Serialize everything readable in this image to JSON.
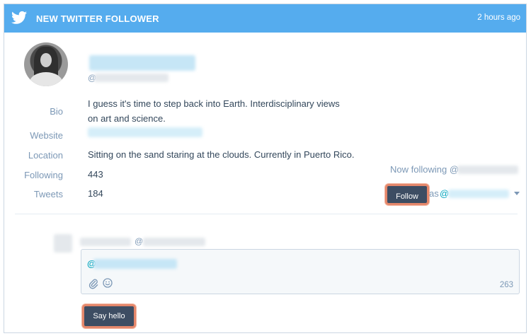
{
  "header": {
    "title": "NEW TWITTER FOLLOWER",
    "time": "2 hours ago"
  },
  "profile": {
    "handle_prefix": "@",
    "fields": {
      "bio_label": "Bio",
      "bio_value": "I guess it's time to step back into Earth. Interdisciplinary views on art and science.",
      "website_label": "Website",
      "location_label": "Location",
      "location_value": "Sitting on the sand staring at the clouds. Currently in Puerto Rico.",
      "following_label": "Following",
      "following_value": "443",
      "tweets_label": "Tweets",
      "tweets_value": "184"
    }
  },
  "actions": {
    "now_following_prefix": "Now following @",
    "follow_label": "Follow",
    "as_label": "as",
    "as_at": "@"
  },
  "compose": {
    "sender_at": "@",
    "at_prefix": "@",
    "char_count": "263",
    "submit_label": "Say hello"
  },
  "icons": {
    "brand": "twitter-bird-icon",
    "attach": "paperclip-icon",
    "emoji": "smiley-icon",
    "dropdown": "caret-down-icon"
  },
  "colors": {
    "header_bg": "#55acee",
    "button_bg": "#3d4d63",
    "highlight": "#e4876b",
    "accent": "#00a4bd"
  }
}
